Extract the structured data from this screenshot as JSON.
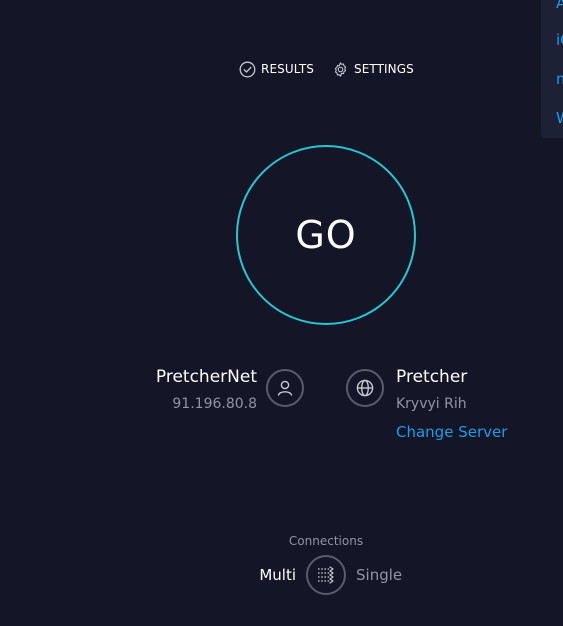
{
  "side_menu": {
    "items": [
      "A",
      "iO",
      "m",
      "W"
    ]
  },
  "nav": {
    "results_label": "RESULTS",
    "settings_label": "SETTINGS"
  },
  "go_button": {
    "label": "GO"
  },
  "isp": {
    "name": "PretcherNet",
    "ip": "91.196.80.8",
    "icon": "user-icon"
  },
  "server": {
    "name": "Pretcher",
    "location": "Kryvyi Rih",
    "change_label": "Change Server",
    "icon": "globe-icon"
  },
  "connections": {
    "label": "Connections",
    "multi_label": "Multi",
    "single_label": "Single",
    "selected": "Multi"
  },
  "colors": {
    "background": "#141526",
    "accent": "#26c7cf",
    "link": "#1e9ce8",
    "muted_text": "#9193a6",
    "icon_ring": "#5a5c6e"
  }
}
